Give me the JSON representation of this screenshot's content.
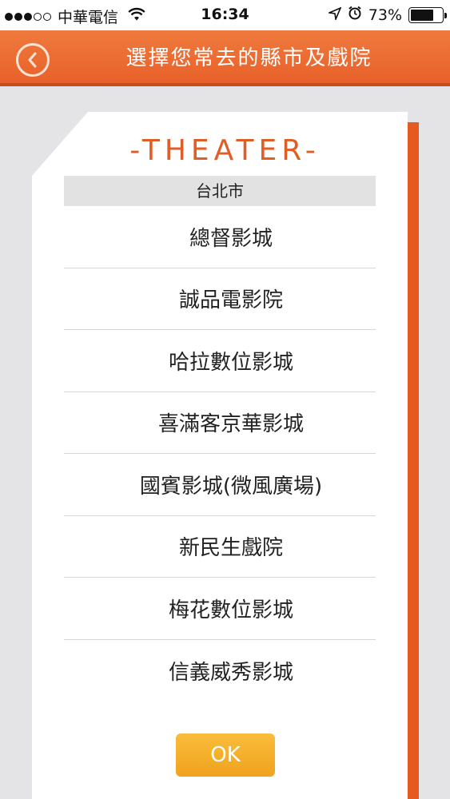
{
  "status_bar": {
    "carrier": "中華電信",
    "time": "16:34",
    "battery_percent_text": "73%",
    "battery_level": 0.73
  },
  "header": {
    "title": "選擇您常去的縣市及戲院",
    "back_icon": "chevron-left-circle-icon"
  },
  "card": {
    "section_label": "-THEATER-",
    "city": "台北市",
    "theaters": [
      "總督影城",
      "誠品電影院",
      "哈拉數位影城",
      "喜滿客京華影城",
      "國賓影城(微風廣場)",
      "新民生戲院",
      "梅花數位影城",
      "信義威秀影城"
    ],
    "ok_label": "OK"
  },
  "colors": {
    "accent": "#e8612a",
    "ok_button": "#f5b02d",
    "theater_label": "#e05e26"
  }
}
